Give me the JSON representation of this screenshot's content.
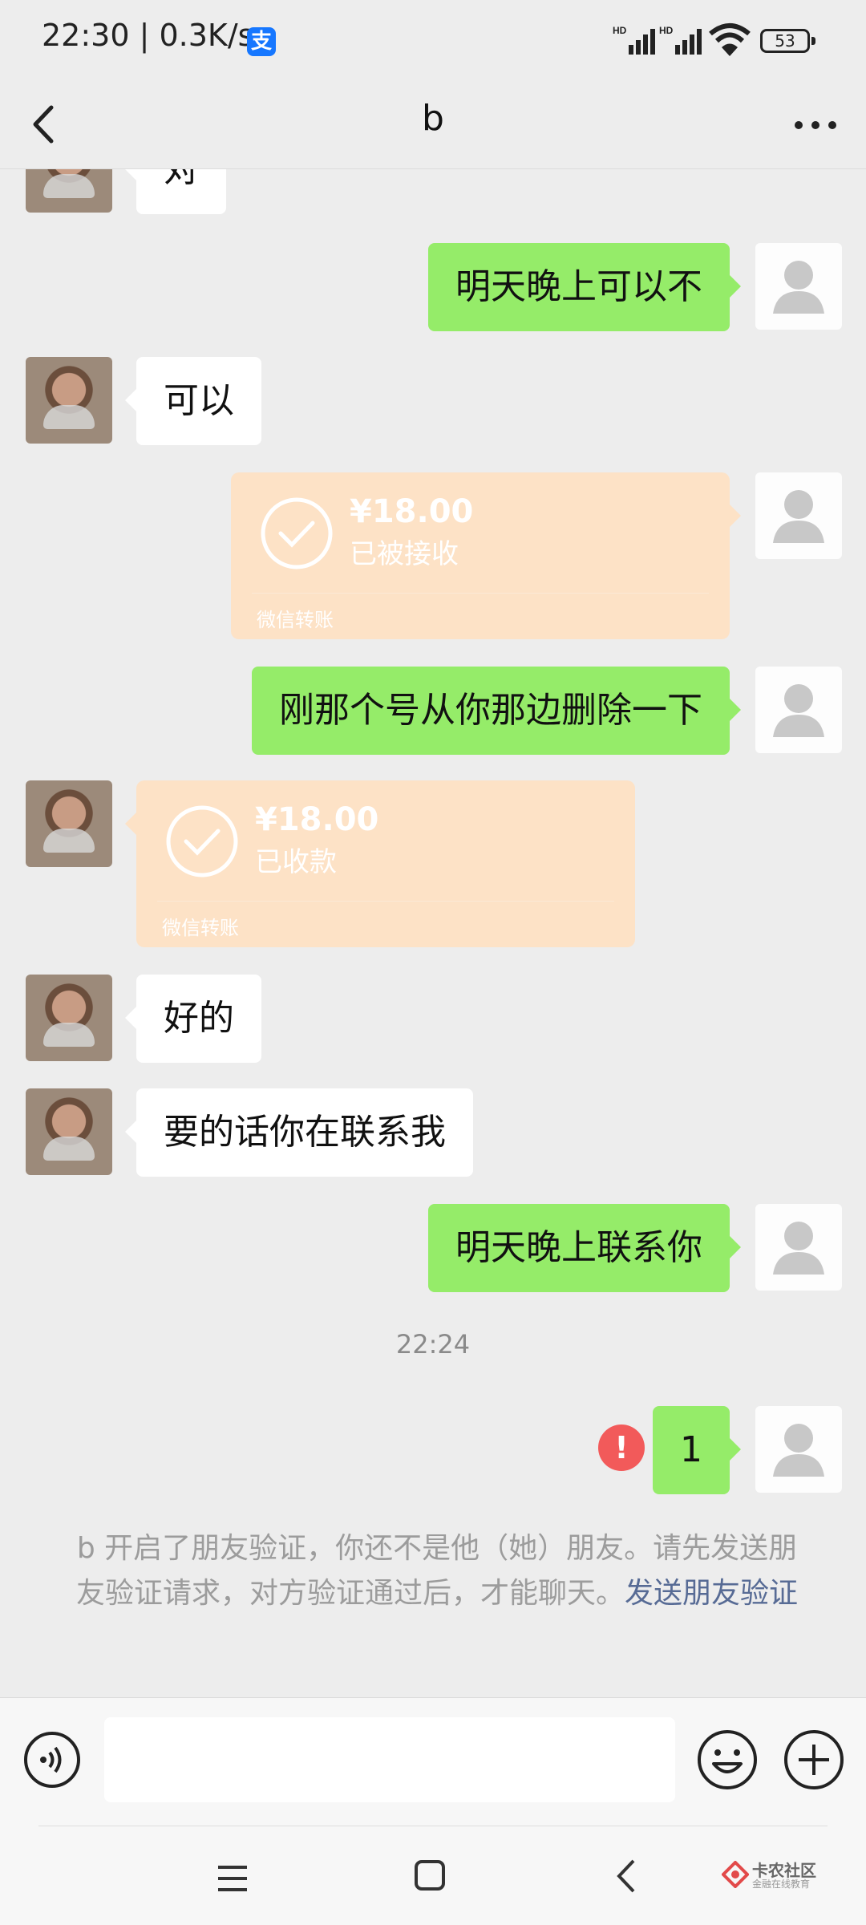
{
  "status_bar": {
    "time_speed": "22:30 | 0.3K/s",
    "alipay_icon": "alipay-icon",
    "signal_label": "HD",
    "battery": "53"
  },
  "header": {
    "title": "b",
    "back_icon": "chevron-left-icon",
    "more_icon": "more-icon"
  },
  "messages": [
    {
      "side": "in",
      "text": "对"
    },
    {
      "side": "out",
      "text": "明天晚上可以不"
    },
    {
      "side": "in",
      "text": "可以"
    },
    {
      "side": "out",
      "type": "transfer",
      "amount": "¥18.00",
      "status": "已被接收",
      "label": "微信转账"
    },
    {
      "side": "out",
      "text": "刚那个号从你那边删除一下"
    },
    {
      "side": "in",
      "type": "transfer",
      "amount": "¥18.00",
      "status": "已收款",
      "label": "微信转账"
    },
    {
      "side": "in",
      "text": "好的"
    },
    {
      "side": "in",
      "text": "要的话你在联系我"
    },
    {
      "side": "out",
      "text": "明天晚上联系你"
    },
    {
      "side": "out",
      "text": "1",
      "failed": true
    }
  ],
  "time_divider": "22:24",
  "error_mark": "!",
  "system_notice": {
    "text": "b 开启了朋友验证，你还不是他（她）朋友。请先发送朋友验证请求，对方验证通过后，才能聊天。",
    "link": "发送朋友验证"
  },
  "input_bar": {
    "value": "",
    "voice_icon": "voice-icon",
    "emoji_icon": "emoji-icon",
    "plus_icon": "plus-icon"
  },
  "nav_bar": {
    "menu_icon": "menu-icon",
    "home_icon": "home-icon",
    "back_icon": "back-icon"
  },
  "watermark": {
    "title": "卡农社区",
    "subtitle": "金融在线教育"
  },
  "colors": {
    "bubble_out": "#95ec69",
    "bubble_in": "#ffffff",
    "transfer": "#fde2c6",
    "link": "#576b95",
    "error": "#f25a5a"
  }
}
